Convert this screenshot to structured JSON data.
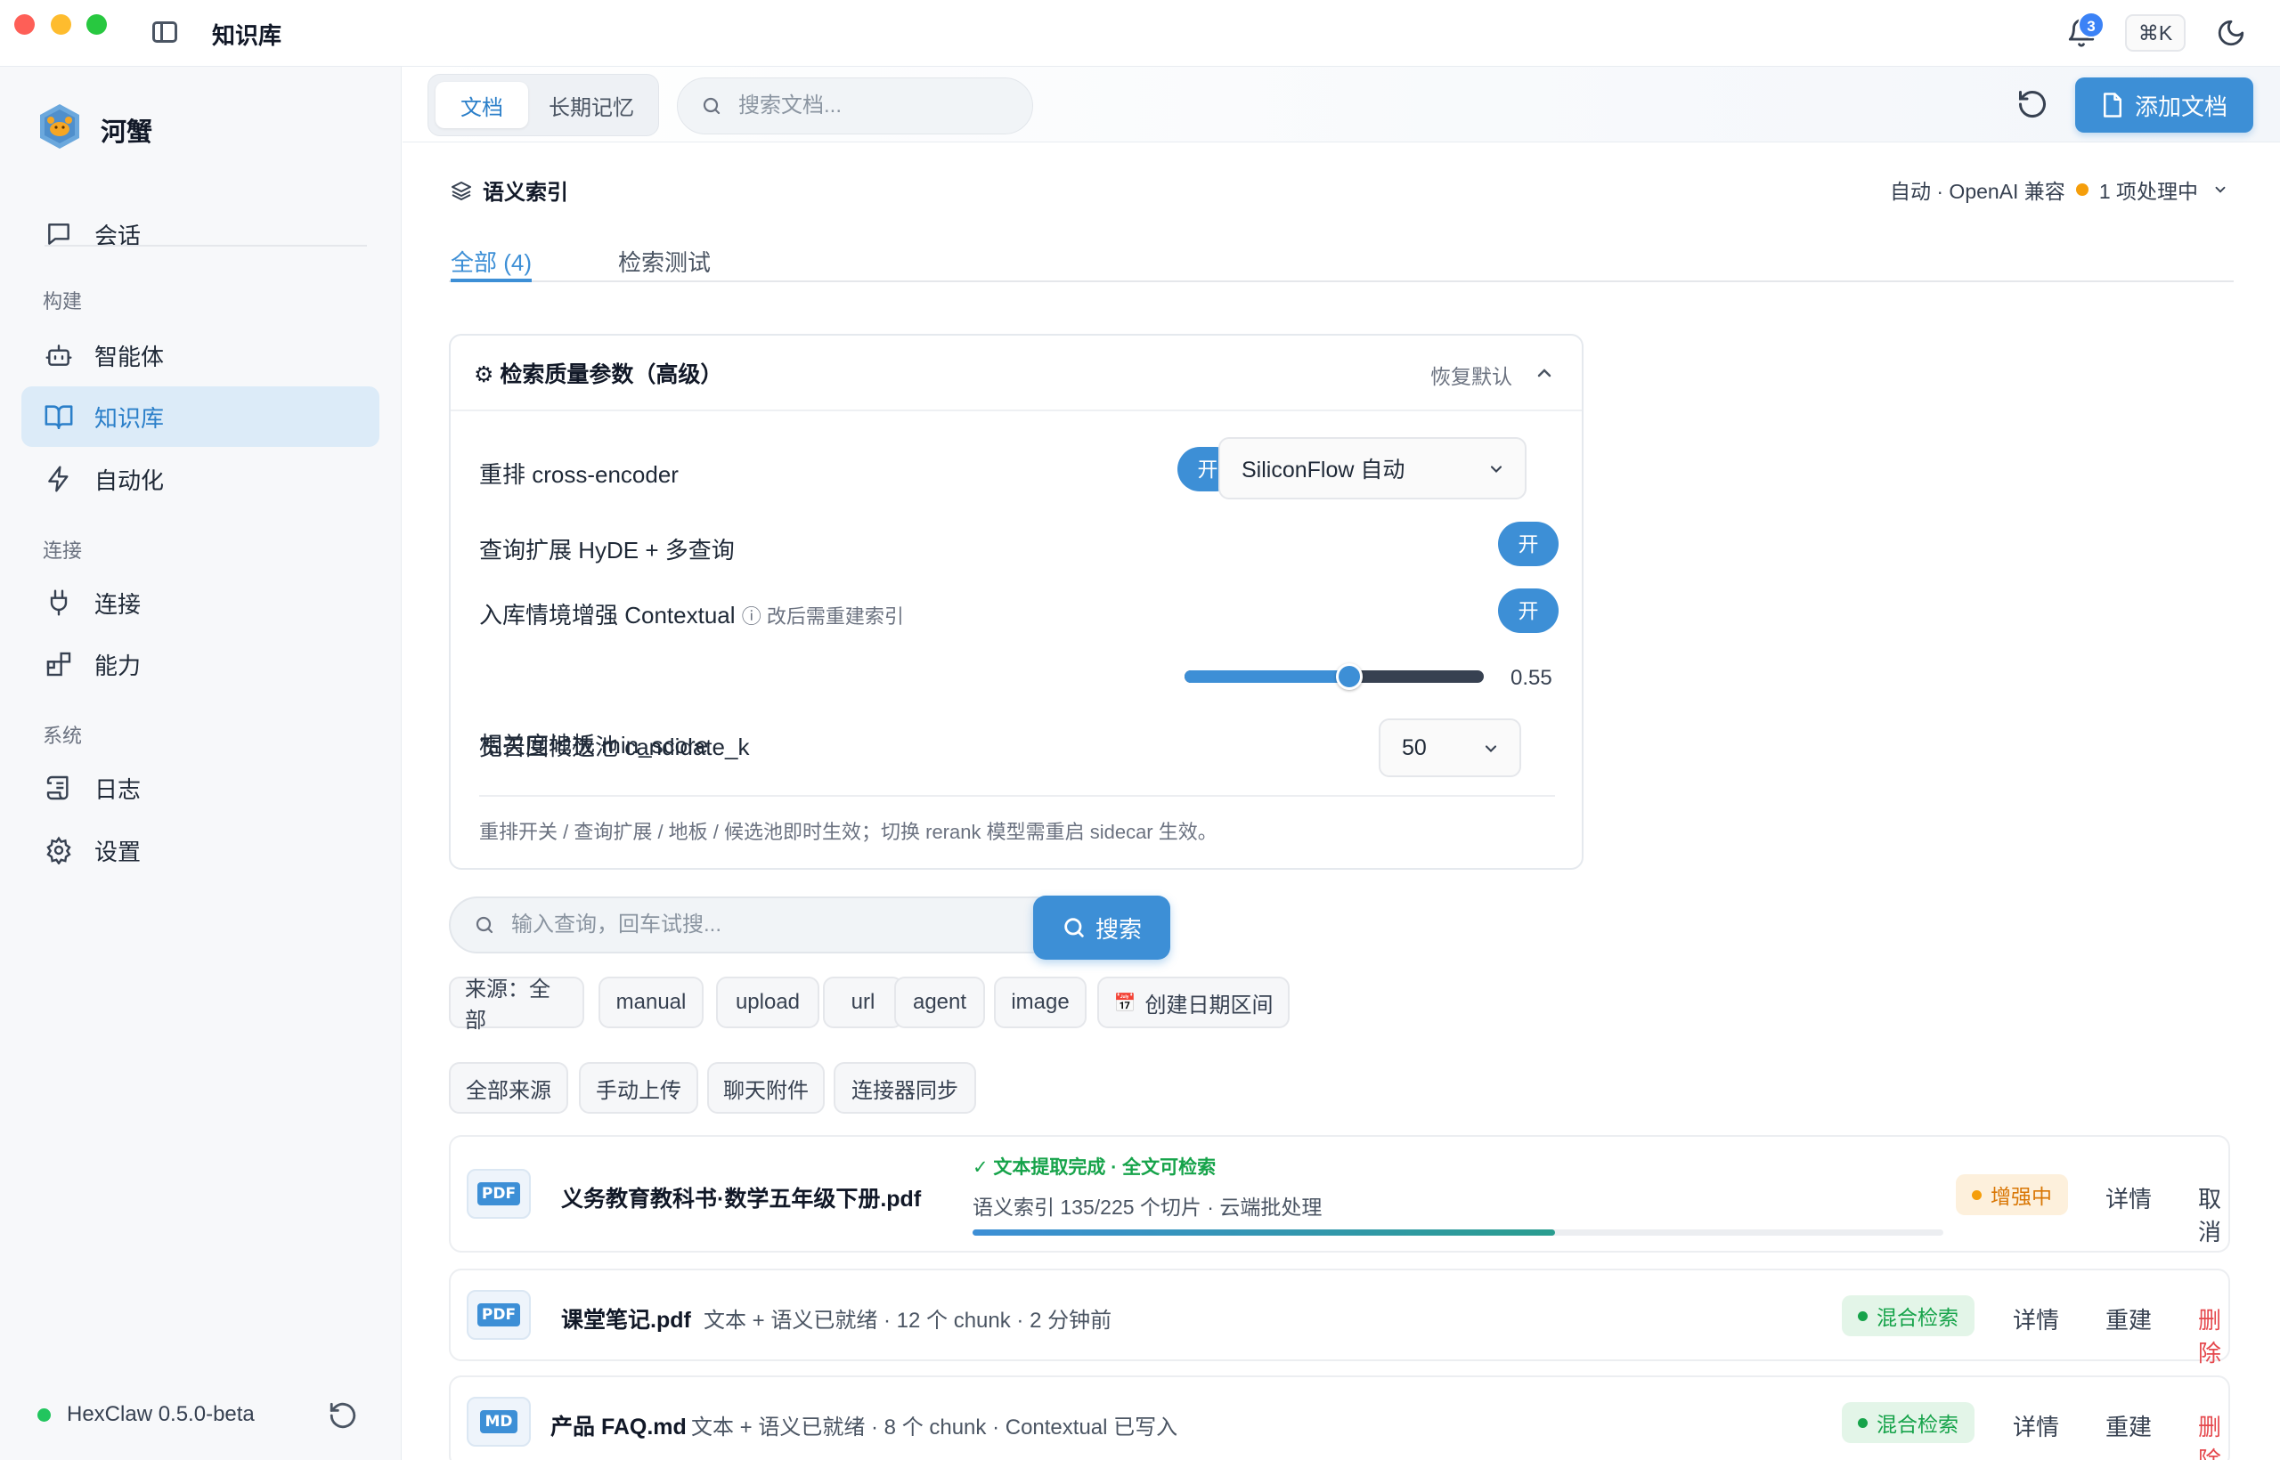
{
  "app": {
    "title": "知识库",
    "notification_count": "3",
    "shortcut": "⌘K"
  },
  "sidebar": {
    "brand": "河蟹",
    "chat_label": "会话",
    "sections": {
      "build": "构建",
      "connect": "连接",
      "system": "系统"
    },
    "items": {
      "agents": "智能体",
      "knowledge": "知识库",
      "automation": "自动化",
      "connectors": "连接",
      "capabilities": "能力",
      "logs": "日志",
      "settings": "设置"
    },
    "version": "HexClaw 0.5.0-beta"
  },
  "header": {
    "tabs": [
      "文档",
      "长期记忆"
    ],
    "search_placeholder": "搜索文档...",
    "add_button": "添加文档"
  },
  "index": {
    "title": "语义索引",
    "status_mode": "自动 · OpenAI 兼容",
    "status_processing": "1 项处理中",
    "tabs": [
      "全部 (4)",
      "检索测试"
    ]
  },
  "params": {
    "title": "⚙ 检索质量参数（高级）",
    "reset": "恢复默认",
    "rerank_label": "重排 cross-encoder",
    "rerank_toggle": "开",
    "rerank_model": "SiliconFlow 自动",
    "expand_label": "查询扩展 HyDE + 多查询",
    "expand_toggle": "开",
    "contextual_label": "入库情境增强 Contextual",
    "contextual_hint": "ⓘ 改后需重建索引",
    "contextual_toggle": "开",
    "min_score_label": "相关度地板 min_score",
    "min_score_value": "0.55",
    "min_score_number": 0.55,
    "candidate_label": "宽召回候选池 candidate_k",
    "candidate_value": "50",
    "note": "重排开关 / 查询扩展 / 地板 / 候选池即时生效；切换 rerank 模型需重启 sidecar 生效。"
  },
  "query": {
    "placeholder": "输入查询，回车试搜...",
    "search_button": "搜索"
  },
  "filters": {
    "source_chips": [
      "来源：全部",
      "manual",
      "upload",
      "url",
      "agent",
      "image"
    ],
    "date_range": "创建日期区间",
    "origin_chips": [
      "全部来源",
      "手动上传",
      "聊天附件",
      "连接器同步"
    ]
  },
  "documents": [
    {
      "type": "PDF",
      "name": "义务教育教科书·数学五年级下册.pdf",
      "status_ok": "✓ 文本提取完成 · 全文可检索",
      "index_progress": "语义索引 135/225 个切片 · 云端批处理",
      "progress": 0.6,
      "badge": "增强中",
      "actions": [
        "详情",
        "取消"
      ]
    },
    {
      "type": "PDF",
      "name": "课堂笔记.pdf",
      "meta": "文本 + 语义已就绪 · 12 个 chunk · 2 分钟前",
      "badge": "混合检索",
      "actions": [
        "详情",
        "重建",
        "删除"
      ]
    },
    {
      "type": "MD",
      "name": "产品 FAQ.md",
      "meta": "文本 + 语义已就绪 · 8 个 chunk · Contextual 已写入",
      "badge": "混合检索",
      "actions": [
        "详情",
        "重建",
        "删除"
      ]
    }
  ],
  "colors": {
    "accent": "#3d8fd6",
    "success": "#16a34a",
    "warning": "#f59e0b",
    "danger": "#e5484d"
  }
}
